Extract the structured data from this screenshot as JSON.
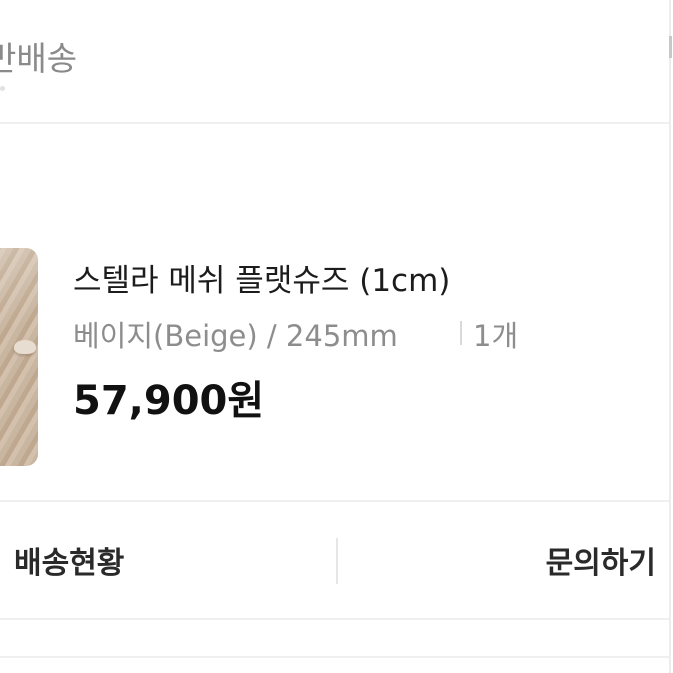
{
  "header": {
    "shipping_type": "반배송"
  },
  "product": {
    "image_alt_icon": "product-thumbnail",
    "name": "스텔라 메쉬 플랫슈즈 (1cm)",
    "option": "베이지(Beige) / 245mm",
    "quantity": "1개",
    "price": "57,900원"
  },
  "actions": {
    "tracking_label": "배송현황",
    "inquiry_label": "문의하기"
  },
  "colors": {
    "divider": "#efefef",
    "secondary_text": "#8d8d8d",
    "primary_text": "#1c1c1c"
  }
}
